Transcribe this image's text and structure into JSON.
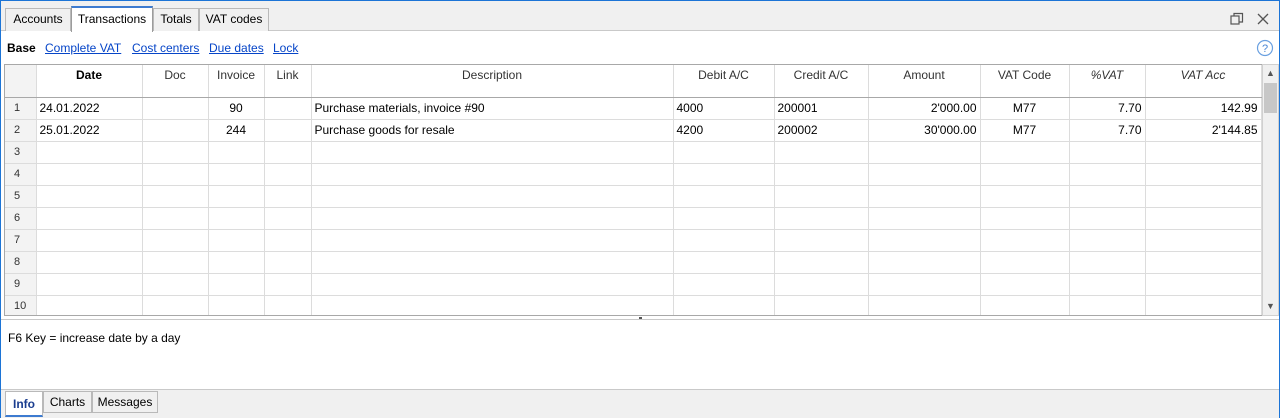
{
  "tabs": [
    {
      "label": "Accounts"
    },
    {
      "label": "Transactions"
    },
    {
      "label": "Totals"
    },
    {
      "label": "VAT codes"
    }
  ],
  "views": {
    "current": "Base",
    "links": [
      "Complete VAT",
      "Cost centers",
      "Due dates",
      "Lock"
    ]
  },
  "table": {
    "columns": [
      "",
      "Date",
      "Doc",
      "Invoice",
      "Link",
      "Description",
      "Debit A/C",
      "Credit A/C",
      "Amount",
      "VAT Code",
      "%VAT",
      "VAT Acc"
    ],
    "rows": [
      {
        "num": "1",
        "date": "24.01.2022",
        "doc": "",
        "invoice": "90",
        "link": "",
        "description": "Purchase materials, invoice #90",
        "debit": "4000",
        "credit": "200001",
        "amount": "2'000.00",
        "vat_code": "M77",
        "vat_pct": "7.70",
        "vat_acc": "142.99"
      },
      {
        "num": "2",
        "date": "25.01.2022",
        "doc": "",
        "invoice": "244",
        "link": "",
        "description": "Purchase goods for resale",
        "debit": "4200",
        "credit": "200002",
        "amount": "30'000.00",
        "vat_code": "M77",
        "vat_pct": "7.70",
        "vat_acc": "2'144.85"
      },
      {
        "num": "3",
        "date": "",
        "doc": "",
        "invoice": "",
        "link": "",
        "description": "",
        "debit": "",
        "credit": "",
        "amount": "",
        "vat_code": "",
        "vat_pct": "",
        "vat_acc": ""
      },
      {
        "num": "4",
        "date": "",
        "doc": "",
        "invoice": "",
        "link": "",
        "description": "",
        "debit": "",
        "credit": "",
        "amount": "",
        "vat_code": "",
        "vat_pct": "",
        "vat_acc": ""
      },
      {
        "num": "5",
        "date": "",
        "doc": "",
        "invoice": "",
        "link": "",
        "description": "",
        "debit": "",
        "credit": "",
        "amount": "",
        "vat_code": "",
        "vat_pct": "",
        "vat_acc": ""
      },
      {
        "num": "6",
        "date": "",
        "doc": "",
        "invoice": "",
        "link": "",
        "description": "",
        "debit": "",
        "credit": "",
        "amount": "",
        "vat_code": "",
        "vat_pct": "",
        "vat_acc": ""
      },
      {
        "num": "7",
        "date": "",
        "doc": "",
        "invoice": "",
        "link": "",
        "description": "",
        "debit": "",
        "credit": "",
        "amount": "",
        "vat_code": "",
        "vat_pct": "",
        "vat_acc": ""
      },
      {
        "num": "8",
        "date": "",
        "doc": "",
        "invoice": "",
        "link": "",
        "description": "",
        "debit": "",
        "credit": "",
        "amount": "",
        "vat_code": "",
        "vat_pct": "",
        "vat_acc": ""
      },
      {
        "num": "9",
        "date": "",
        "doc": "",
        "invoice": "",
        "link": "",
        "description": "",
        "debit": "",
        "credit": "",
        "amount": "",
        "vat_code": "",
        "vat_pct": "",
        "vat_acc": ""
      },
      {
        "num": "10",
        "date": "",
        "doc": "",
        "invoice": "",
        "link": "",
        "description": "",
        "debit": "",
        "credit": "",
        "amount": "",
        "vat_code": "",
        "vat_pct": "",
        "vat_acc": ""
      }
    ]
  },
  "info": {
    "text": "F6 Key = increase date by a day"
  },
  "bottom_tabs": [
    {
      "label": "Info"
    },
    {
      "label": "Charts"
    },
    {
      "label": "Messages"
    }
  ],
  "icons": {
    "restore": "restore-window-icon",
    "help": "help-icon",
    "scroll_up": "chevron-up-icon",
    "scroll_down": "chevron-down-icon"
  },
  "colors": {
    "accent": "#3d7bd0",
    "link": "#0645c8",
    "frame": "#1c74d6"
  }
}
